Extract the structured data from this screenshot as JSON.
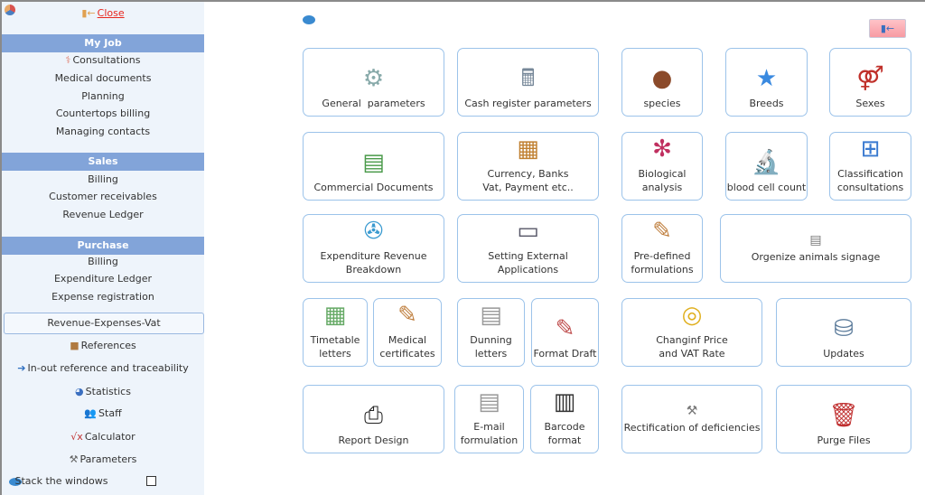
{
  "sidebar": {
    "close": "Close",
    "sections": [
      {
        "title": "My Job",
        "items": [
          "Consultations",
          "Medical documents",
          "Planning",
          "Countertops billing",
          "Managing contacts"
        ]
      },
      {
        "title": "Sales",
        "items": [
          "Billing",
          "Customer receivables",
          "Revenue Ledger"
        ]
      },
      {
        "title": "Purchase",
        "items": [
          "Billing",
          "Expenditure Ledger",
          "Expense registration"
        ]
      }
    ],
    "rev_button": "Revenue-Expenses-Vat",
    "links": [
      "References",
      "In-out reference and traceability",
      "Statistics",
      "Staff",
      "Calculator",
      "Parameters"
    ],
    "stack_label": "Stack the windows",
    "stack_checked": false
  },
  "colors": {
    "header": "#82a4d9",
    "sidebar_bg": "#eef4fb",
    "tile_border": "#9cc3ea",
    "close": "#e8261d"
  },
  "tiles": [
    {
      "label": "General  parameters",
      "icon": "gears-icon"
    },
    {
      "label": "Cash register parameters",
      "icon": "cash-register-icon"
    },
    {
      "label": "species",
      "icon": "goomba-icon"
    },
    {
      "label": "Breeds",
      "icon": "blue-star-icon"
    },
    {
      "label": "Sexes",
      "icon": "gender-symbols-icon"
    },
    {
      "label": "Commercial Documents",
      "icon": "spreadsheet-icon"
    },
    {
      "label": "Currency, Banks\nVat, Payment etc..",
      "icon": "notepad-icon"
    },
    {
      "label": "Biological\nanalysis",
      "icon": "molecule-icon"
    },
    {
      "label": "blood cell count",
      "icon": "microscope-icon"
    },
    {
      "label": "Classification\nconsultations",
      "icon": "hierarchy-icon"
    },
    {
      "label": "Expenditure Revenue\nBreakdown",
      "icon": "fan-icon"
    },
    {
      "label": "Setting External Applications",
      "icon": "windows-icon"
    },
    {
      "label": "Pre-defined\nformulations",
      "icon": "pen-icon"
    },
    {
      "label": "Orgenize animals signage",
      "icon": "sign-icon"
    },
    {
      "label": "Timetable\nletters",
      "icon": "calculator-icon"
    },
    {
      "label": "Medical\ncertificates",
      "icon": "pen-icon"
    },
    {
      "label": "Dunning\nletters",
      "icon": "text-doc-icon"
    },
    {
      "label": "Format Draft",
      "icon": "draft-icon"
    },
    {
      "label": "Changinf Price\nand VAT Rate",
      "icon": "coins-icon"
    },
    {
      "label": "Updates",
      "icon": "database-icon"
    },
    {
      "label": "Report Design",
      "icon": "printer-icon"
    },
    {
      "label": "E-mail\nformulation",
      "icon": "text-doc-icon"
    },
    {
      "label": "Barcode\nformat",
      "icon": "barcode-icon"
    },
    {
      "label": "Rectification of deficiencies",
      "icon": "tools-icon"
    },
    {
      "label": "Purge Files",
      "icon": "trash-icon"
    }
  ]
}
